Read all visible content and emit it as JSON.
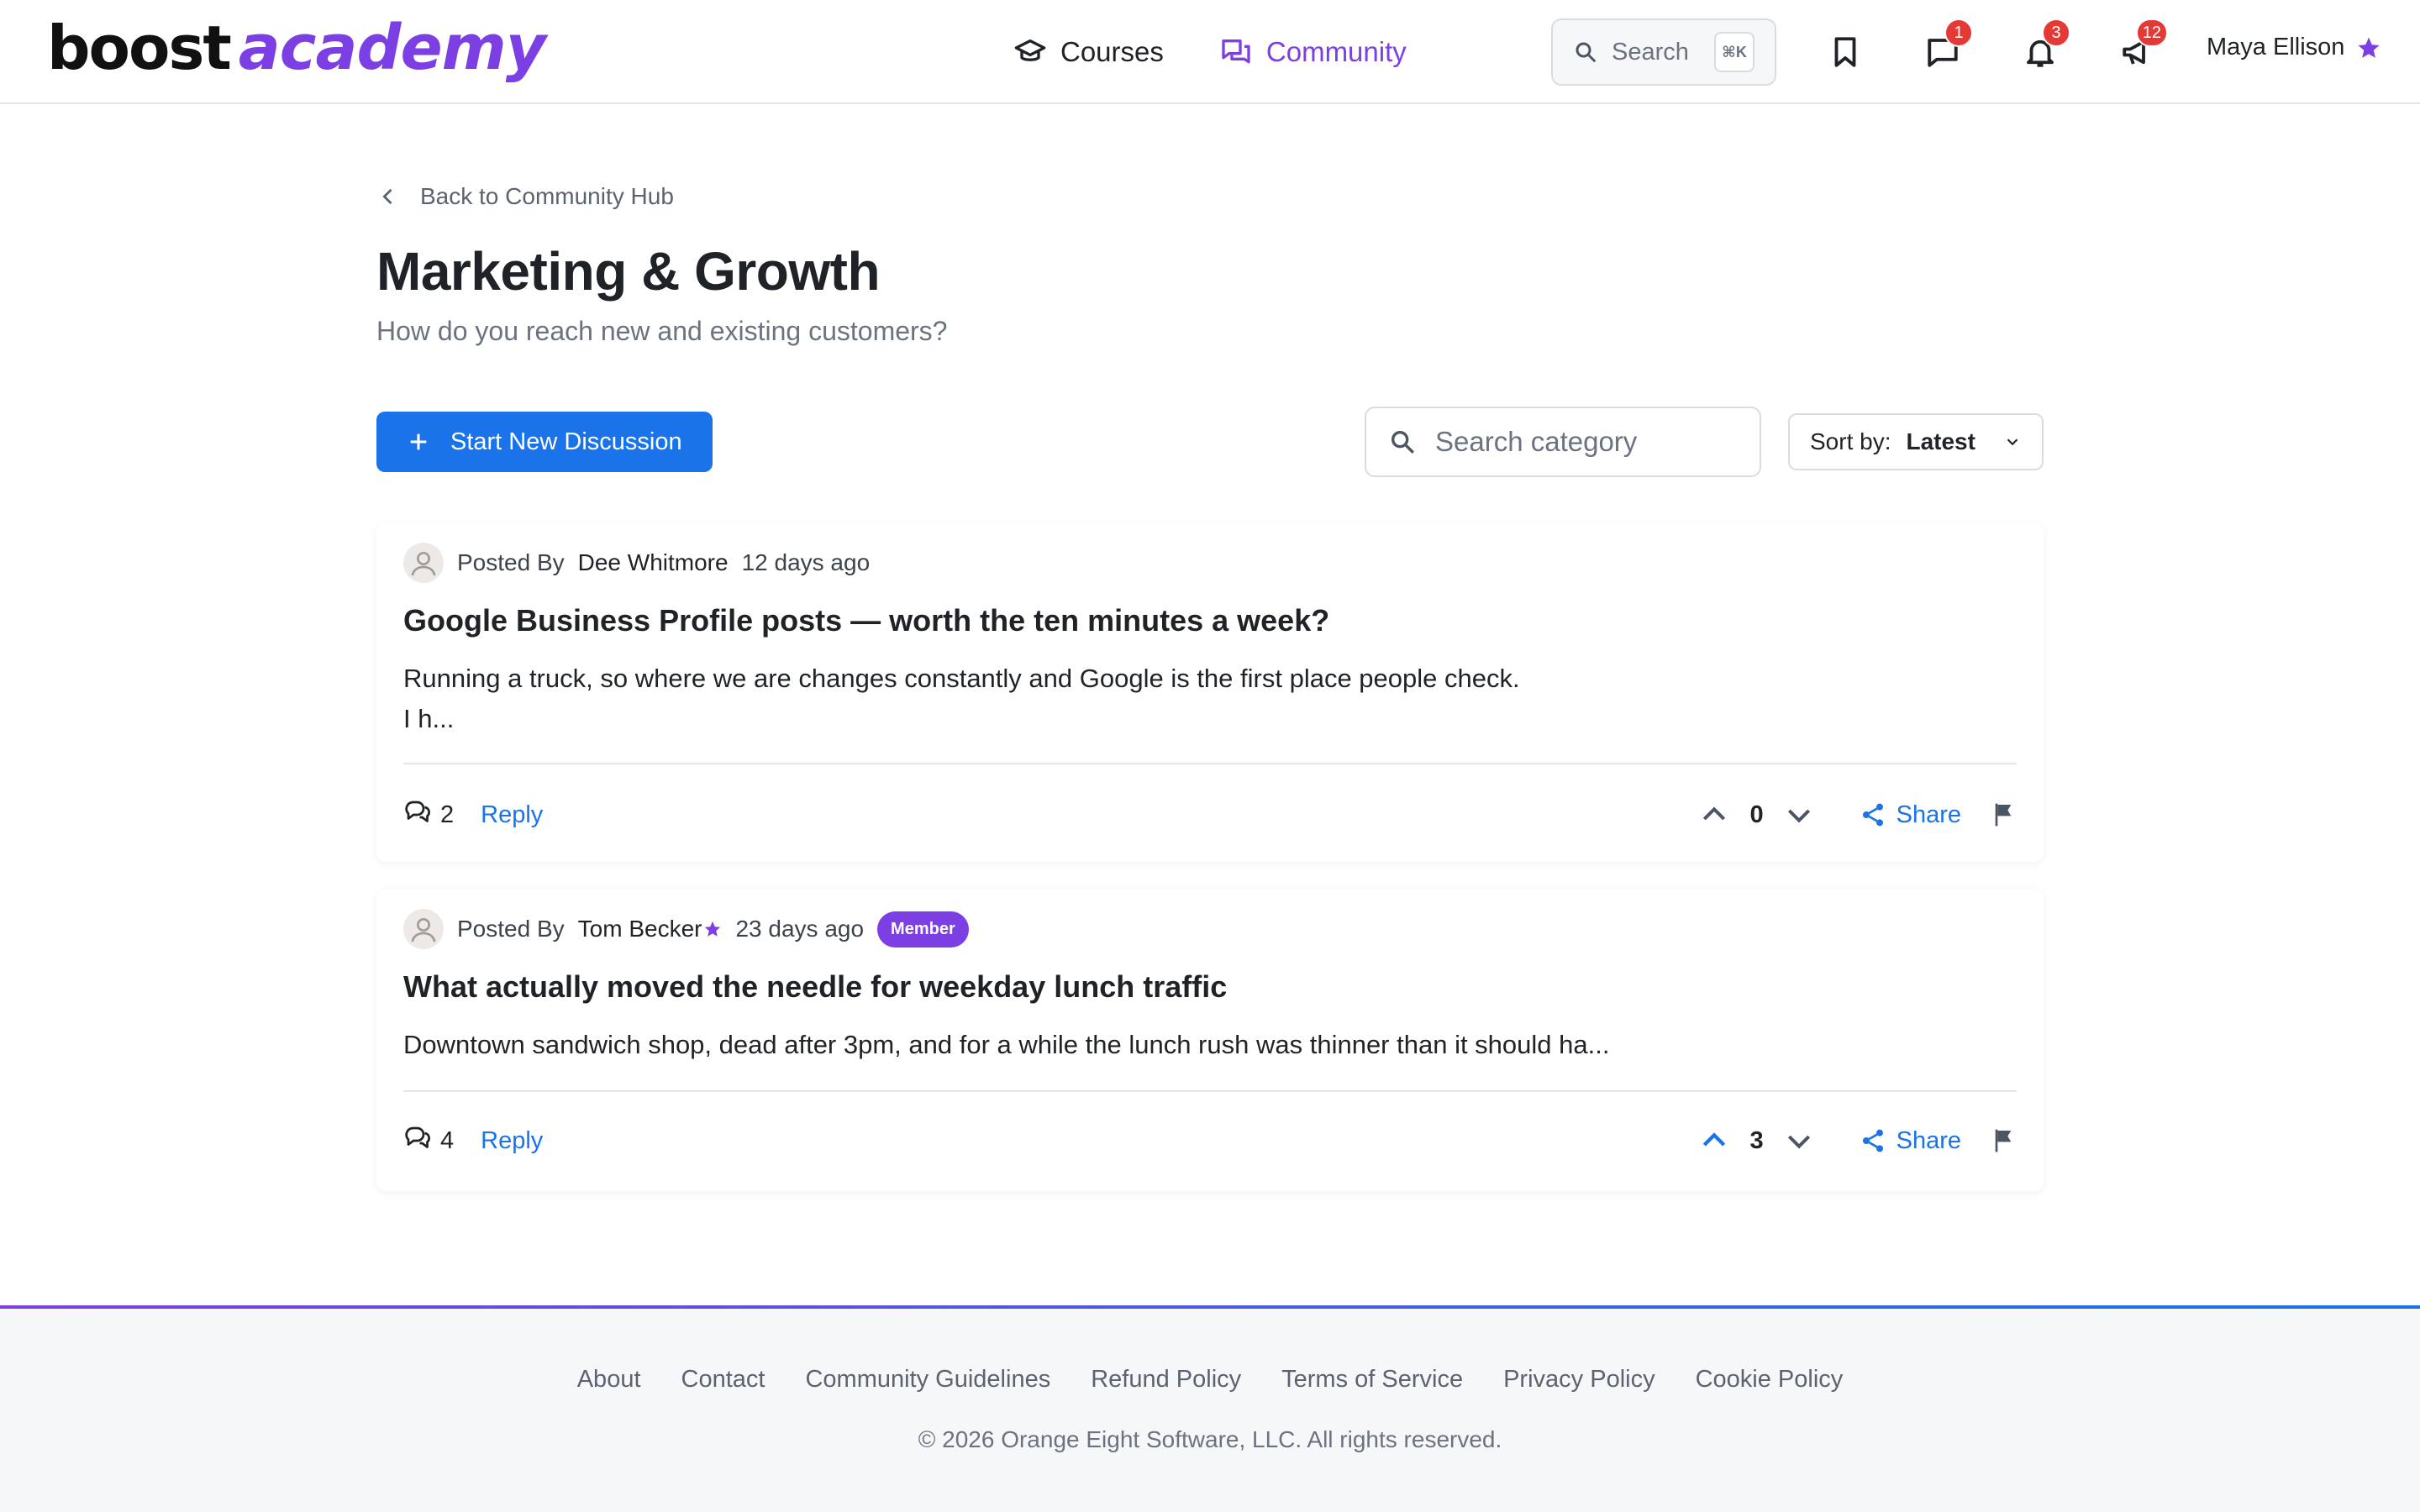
{
  "brand": {
    "logo_part1": "boost",
    "logo_part2": "academy"
  },
  "nav": {
    "courses": "Courses",
    "community": "Community"
  },
  "header": {
    "search_label": "Search",
    "search_shortcut": "⌘K",
    "messages_badge": "1",
    "notifications_badge": "3",
    "announcements_badge": "12",
    "user_name": "Maya Ellison"
  },
  "page": {
    "back_label": "Back to Community Hub",
    "title": "Marketing & Growth",
    "subtitle": "How do you reach new and existing customers?",
    "start_button": "Start New Discussion",
    "search_placeholder": "Search category",
    "sort_label": "Sort by:",
    "sort_value": "Latest"
  },
  "posts": [
    {
      "posted_by": "Posted By",
      "author": "Dee Whitmore",
      "time": "12 days ago",
      "title": "Google Business Profile posts — worth the ten minutes a week?",
      "body_line1": "Running a truck, so where we are changes constantly and Google is the first place people check.",
      "body_line2": "I h...",
      "comments": "2",
      "reply": "Reply",
      "votes": "0",
      "share": "Share"
    },
    {
      "posted_by": "Posted By",
      "author": "Tom Becker",
      "time": "23 days ago",
      "badge": "Member",
      "title": "What actually moved the needle for weekday lunch traffic",
      "body_line1": "Downtown sandwich shop, dead after 3pm, and for a while the lunch rush was thinner than it should ha...",
      "comments": "4",
      "reply": "Reply",
      "votes": "3",
      "share": "Share"
    }
  ],
  "footer": {
    "links": [
      "About",
      "Contact",
      "Community Guidelines",
      "Refund Policy",
      "Terms of Service",
      "Privacy Policy",
      "Cookie Policy"
    ],
    "copyright": "© 2026 Orange Eight Software, LLC. All rights reserved."
  },
  "colors": {
    "accent_purple": "#7b3fe4",
    "primary_blue": "#1a73e8",
    "badge_red": "#e53935"
  }
}
